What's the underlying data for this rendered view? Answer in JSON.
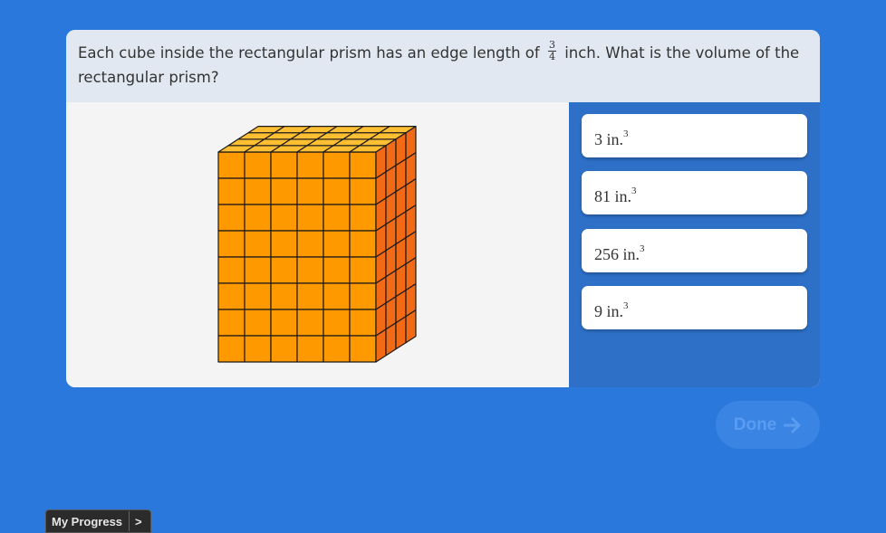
{
  "question": {
    "text_before": "Each cube inside the rectangular prism has an edge length of",
    "fraction_numerator": "3",
    "fraction_denominator": "4",
    "text_after": "inch. What is the volume of the rectangular prism?"
  },
  "figure": {
    "cubes_wide": 6,
    "cubes_high": 8,
    "cubes_deep": 4,
    "front_color": "#ff9900",
    "top_color": "#ffbf33",
    "side_color": "#f26a16"
  },
  "choices": [
    {
      "value": "3 in.",
      "exponent": "3"
    },
    {
      "value": "81 in.",
      "exponent": "3"
    },
    {
      "value": "256 in.",
      "exponent": "3"
    },
    {
      "value": "9 in.",
      "exponent": "3"
    }
  ],
  "done_label": "Done",
  "progress": {
    "label": "My Progress",
    "arrow": ">"
  }
}
